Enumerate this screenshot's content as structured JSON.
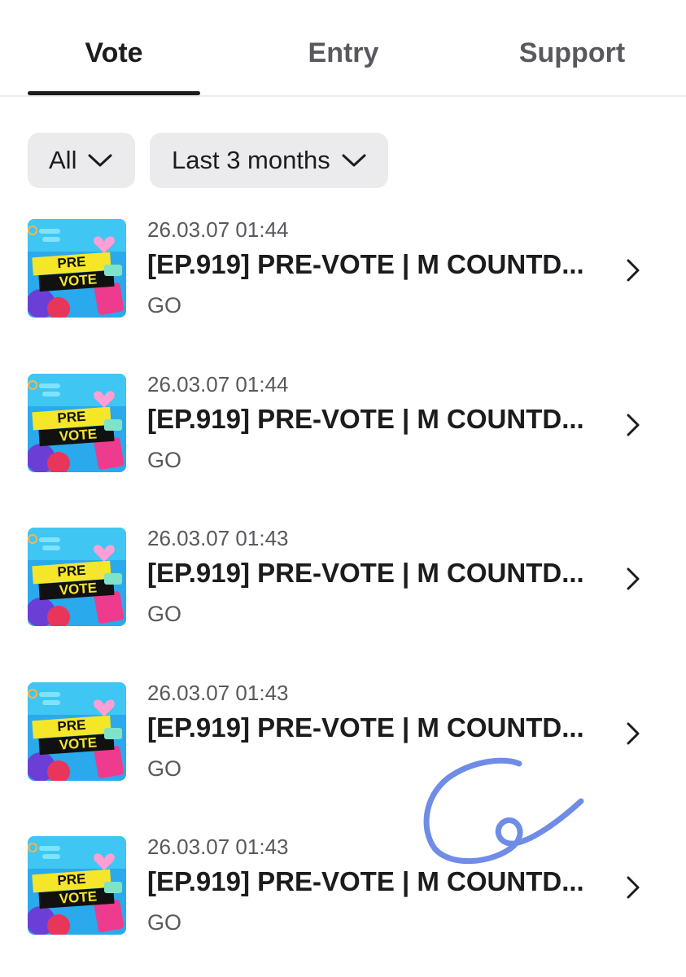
{
  "tabs": [
    {
      "label": "Vote",
      "active": true
    },
    {
      "label": "Entry",
      "active": false
    },
    {
      "label": "Support",
      "active": false
    }
  ],
  "filters": {
    "type_label": "All",
    "period_label": "Last 3 months"
  },
  "thumbnail": {
    "line1": "PRE",
    "line2": "VOTE"
  },
  "items": [
    {
      "date": "26.03.07 01:44",
      "title": "[EP.919] PRE-VOTE | M COUNTD...",
      "status": "GO"
    },
    {
      "date": "26.03.07 01:44",
      "title": "[EP.919] PRE-VOTE | M COUNTD...",
      "status": "GO"
    },
    {
      "date": "26.03.07 01:43",
      "title": "[EP.919] PRE-VOTE | M COUNTD...",
      "status": "GO"
    },
    {
      "date": "26.03.07 01:43",
      "title": "[EP.919] PRE-VOTE | M COUNTD...",
      "status": "GO"
    },
    {
      "date": "26.03.07 01:43",
      "title": "[EP.919] PRE-VOTE | M COUNTD...",
      "status": "GO"
    }
  ],
  "colors": {
    "signature": "#6f8de6",
    "thumbnail_background": "#2aa9ec",
    "thumbnail_banner": "#f5e62a"
  }
}
